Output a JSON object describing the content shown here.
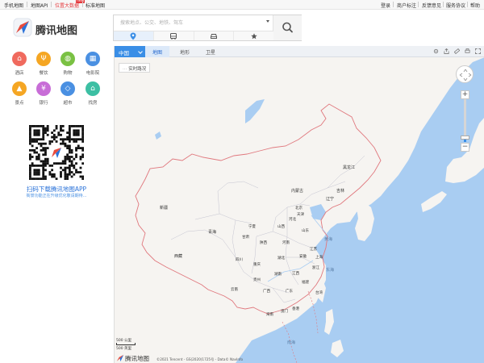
{
  "topbar": {
    "left_links": [
      "手机地图",
      "地图API",
      "位置大数据",
      "标准地图"
    ],
    "new_badge": "new",
    "right_links": [
      "登录",
      "商户标注",
      "反馈意见",
      "服务协议",
      "帮助"
    ]
  },
  "brand": {
    "name": "腾讯地图"
  },
  "search": {
    "placeholder": "搜索地点、公交、地铁、驾车",
    "button_icon": "search-icon",
    "modes": [
      {
        "icon": "location-pin-icon",
        "active": true
      },
      {
        "icon": "bus-icon",
        "active": false
      },
      {
        "icon": "car-icon",
        "active": false
      },
      {
        "icon": "star-icon",
        "active": false
      }
    ]
  },
  "categories": [
    {
      "label": "酒店",
      "color": "#f06a5e",
      "glyph": "⌂",
      "icon": "hotel-icon"
    },
    {
      "label": "餐饮",
      "color": "#f5a623",
      "glyph": "Ψ",
      "icon": "restaurant-icon"
    },
    {
      "label": "购物",
      "color": "#7ac143",
      "glyph": "◍",
      "icon": "shopping-icon"
    },
    {
      "label": "电影院",
      "color": "#4a90e2",
      "glyph": "▦",
      "icon": "cinema-icon"
    },
    {
      "label": "景点",
      "color": "#f5a623",
      "glyph": "▲",
      "icon": "scenic-icon"
    },
    {
      "label": "银行",
      "color": "#c86dd7",
      "glyph": "¥",
      "icon": "bank-icon"
    },
    {
      "label": "超市",
      "color": "#4a90e2",
      "glyph": "◇",
      "icon": "supermarket-icon"
    },
    {
      "label": "找房",
      "color": "#3cbfa3",
      "glyph": "⌂",
      "icon": "house-icon"
    }
  ],
  "qr": {
    "title": "扫码下载腾讯地图APP",
    "subtitle": "街景功能正在升级优化敬请期待..."
  },
  "map": {
    "region": "中国",
    "tabs": [
      {
        "label": "地图",
        "active": true
      },
      {
        "label": "地形",
        "active": false
      },
      {
        "label": "卫星",
        "active": false
      }
    ],
    "traffic_button": "实时路况",
    "zoom_in": "+",
    "zoom_out": "−",
    "zoom_level_fraction": 0.12,
    "land_color": "#f6f4f1",
    "sea_color": "#a9cdf2",
    "border_color": "#e0787e",
    "scale": {
      "top": "500 公里",
      "bottom": "500 英里"
    },
    "bottom_logo_text": "腾讯地图",
    "copyright": "©2021 Tencent - GS(2020)1725号 - Data© NavInfo",
    "provinces": [
      "黑龙江",
      "吉林",
      "辽宁",
      "内蒙古",
      "北京",
      "天津",
      "河北",
      "山西",
      "山东",
      "新疆",
      "宁夏",
      "陕西",
      "河南",
      "青海",
      "甘肃",
      "江苏",
      "安徽",
      "上海",
      "西藏",
      "四川",
      "重庆",
      "湖北",
      "浙江",
      "江西",
      "湖南",
      "贵州",
      "福建",
      "云南",
      "广西",
      "广东",
      "台湾",
      "澳门",
      "香港",
      "海南"
    ],
    "seas": [
      "黄海",
      "东海",
      "南海"
    ]
  }
}
